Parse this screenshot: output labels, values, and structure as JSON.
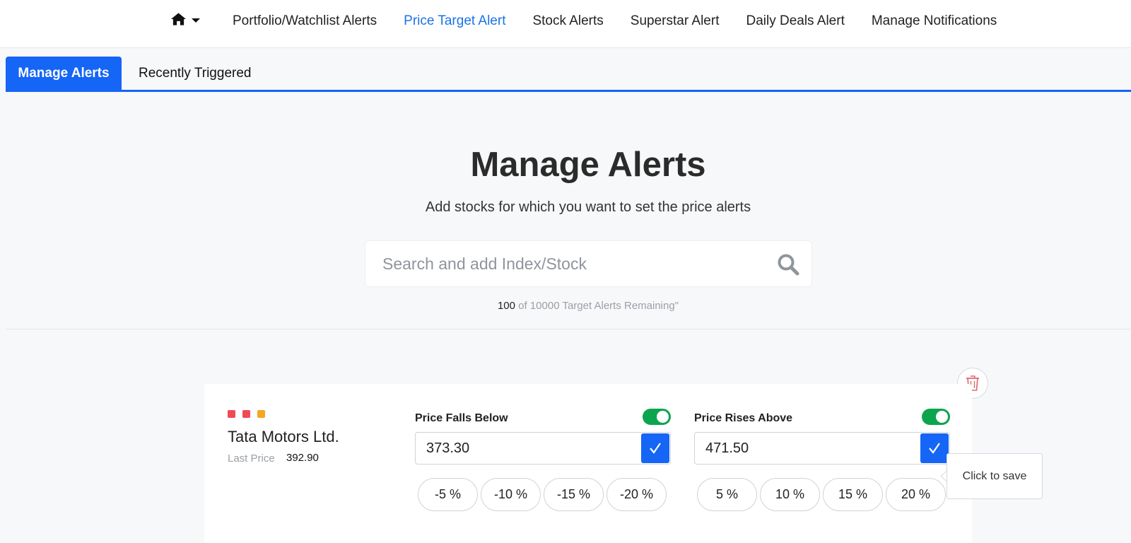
{
  "nav": {
    "home_icon": "home-icon",
    "links": [
      {
        "label": "Portfolio/Watchlist Alerts"
      },
      {
        "label": "Price Target Alert"
      },
      {
        "label": "Stock Alerts"
      },
      {
        "label": "Superstar Alert"
      },
      {
        "label": "Daily Deals Alert"
      },
      {
        "label": "Manage Notifications"
      }
    ],
    "active_color": "#1a73e8"
  },
  "tabs": [
    {
      "label": "Manage Alerts"
    },
    {
      "label": "Recently Triggered"
    }
  ],
  "hero": {
    "title": "Manage Alerts",
    "subtitle": "Add stocks for which you want to set the price alerts"
  },
  "search": {
    "placeholder": "Search and add Index/Stock",
    "value": "",
    "icon": "search-icon"
  },
  "remaining": {
    "count": "100",
    "text": " of 10000 Target Alerts Remaining\""
  },
  "alert": {
    "dot_colors": [
      "#f04a55",
      "#f04a55",
      "#f5a623"
    ],
    "stock_name": "Tata Motors Ltd.",
    "last_price_label": "Last Price",
    "last_price": "392.90",
    "falls": {
      "label": "Price Falls Below",
      "value": "373.30",
      "enabled": true,
      "chips": [
        "-5 %",
        "-10 %",
        "-15 %",
        "-20 %"
      ]
    },
    "rises": {
      "label": "Price Rises Above",
      "value": "471.50",
      "enabled": true,
      "chips": [
        "5 %",
        "10 %",
        "15 %",
        "20 %"
      ]
    }
  },
  "tooltip": {
    "text": "Click to save"
  },
  "colors": {
    "accent": "#1565f6",
    "toggle_on": "#0ca44d"
  }
}
